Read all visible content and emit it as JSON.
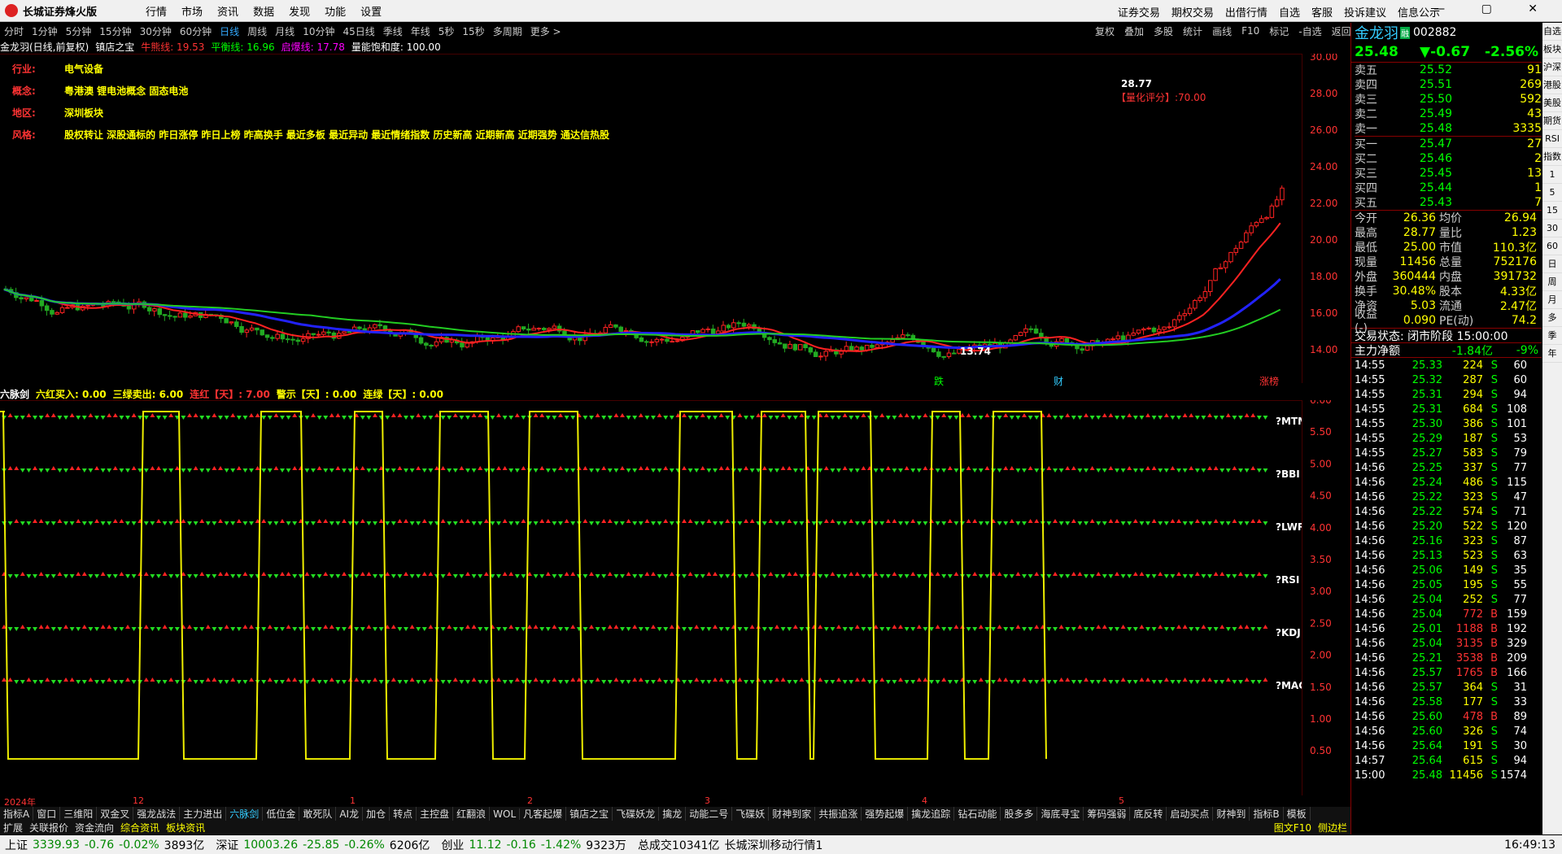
{
  "app": {
    "title": "长城证券烽火版",
    "menu": [
      "行情",
      "市场",
      "资讯",
      "数据",
      "发现",
      "功能",
      "设置"
    ],
    "right_menu": [
      "证券交易",
      "期权交易",
      "出借行情",
      "自选",
      "客服",
      "投诉建议",
      "信息公示"
    ]
  },
  "periods": [
    "分时",
    "1分钟",
    "5分钟",
    "15分钟",
    "30分钟",
    "60分钟",
    "日线",
    "周线",
    "月线",
    "10分钟",
    "45日线",
    "季线",
    "年线",
    "5秒",
    "15秒",
    "多周期",
    "更多 >"
  ],
  "active_period": "日线",
  "toolbar": [
    "复权",
    "叠加",
    "多股",
    "统计",
    "画线",
    "F10",
    "标记",
    "-自选",
    "返回"
  ],
  "chart_header": {
    "name": "金龙羽(日线,前复权)",
    "indicator": "镇店之宝",
    "niu": "牛熊线: 19.53",
    "ping": "平衡线: 16.96",
    "qi": "启爆线: 17.78",
    "liang": "量能饱和度: 100.00"
  },
  "info": [
    {
      "k": "行业:",
      "v": "电气设备"
    },
    {
      "k": "概念:",
      "v": "粤港澳 锂电池概念 固态电池"
    },
    {
      "k": "地区:",
      "v": "深圳板块"
    },
    {
      "k": "风格:",
      "v": "股权转让 深股通标的 昨日涨停 昨日上榜 昨高换手 最近多板 最近异动 最近情绪指数 历史新高 近期新高 近期强势 通达信热股"
    }
  ],
  "score": "【量化评分】:70.00",
  "high_label": "28.77",
  "low_label": "13.74",
  "price_axis": [
    "30.00",
    "28.00",
    "26.00",
    "24.00",
    "22.00",
    "20.00",
    "18.00",
    "16.00",
    "14.00"
  ],
  "ind_header": {
    "name": "六脉剑",
    "a": "六红买入: 0.00",
    "b": "三绿卖出: 6.00",
    "c": "连红【天】: 7.00",
    "d": "警示【天】: 0.00",
    "e": "连绿【天】: 0.00"
  },
  "ind_axis": [
    "6.00",
    "5.50",
    "5.00",
    "4.50",
    "4.00",
    "3.50",
    "3.00",
    "2.50",
    "2.00",
    "1.50",
    "1.00",
    "0.50"
  ],
  "ind_labels": [
    "?MTM",
    "?BBI",
    "?LWR",
    "?RSI",
    "?KDJ",
    "?MACD"
  ],
  "date_labels": [
    "2024年",
    "12",
    "1",
    "2",
    "3",
    "4",
    "5"
  ],
  "market_events": [
    "跌",
    "财",
    "涨榜"
  ],
  "bottom_tabs": [
    "指标A",
    "窗口",
    "三维阳",
    "双金叉",
    "强龙战法",
    "主力进出",
    "六脉剑",
    "低位金",
    "敢死队",
    "AI龙",
    "加仓",
    "转点",
    "主控盘",
    "红翻浪",
    "WOL",
    "凡客起爆",
    "镇店之宝",
    "飞碟妖龙",
    "擒龙",
    "动能二号",
    "飞碟妖",
    "财神到家",
    "共振追涨",
    "强势起爆",
    "擒龙追踪",
    "钻石动能",
    "股多多",
    "海底寻宝",
    "筹码强弱",
    "底反转",
    "启动买点",
    "财神到",
    "指标B",
    "模板"
  ],
  "active_tab": "六脉剑",
  "bottom_tabs2": [
    "扩展",
    "关联报价",
    "资金流向",
    "综合资讯",
    "板块资讯"
  ],
  "bottom_right": [
    "图文F10",
    "侧边栏"
  ],
  "stock": {
    "name": "金龙羽",
    "code": "002882",
    "price": "25.48",
    "change": "▼-0.67",
    "pct": "-2.56%",
    "asks": [
      [
        "卖五",
        "25.52",
        "91"
      ],
      [
        "卖四",
        "25.51",
        "269"
      ],
      [
        "卖三",
        "25.50",
        "592"
      ],
      [
        "卖二",
        "25.49",
        "43"
      ],
      [
        "卖一",
        "25.48",
        "3335"
      ]
    ],
    "bids": [
      [
        "买一",
        "25.47",
        "27"
      ],
      [
        "买二",
        "25.46",
        "2"
      ],
      [
        "买三",
        "25.45",
        "13"
      ],
      [
        "买四",
        "25.44",
        "1"
      ],
      [
        "买五",
        "25.43",
        "7"
      ]
    ],
    "stats": [
      [
        "今开",
        "26.36",
        "均价",
        "26.94"
      ],
      [
        "最高",
        "28.77",
        "量比",
        "1.23"
      ],
      [
        "最低",
        "25.00",
        "市值",
        "110.3亿"
      ],
      [
        "现量",
        "11456",
        "总量",
        "752176"
      ],
      [
        "外盘",
        "360444",
        "内盘",
        "391732"
      ],
      [
        "换手",
        "30.48%",
        "股本",
        "4.33亿"
      ],
      [
        "净资",
        "5.03",
        "流通",
        "2.47亿"
      ],
      [
        "收益(-)",
        "0.090",
        "PE(动)",
        "74.2"
      ]
    ],
    "state": "交易状态: 闭市阶段 15:00:00",
    "flow_label": "主力净额",
    "flow_val": "-1.84亿",
    "flow_pct": "-9%"
  },
  "ticks": [
    [
      "14:55",
      "25.33",
      "224",
      "S",
      "60"
    ],
    [
      "14:55",
      "25.32",
      "287",
      "S",
      "60"
    ],
    [
      "14:55",
      "25.31",
      "294",
      "S",
      "94"
    ],
    [
      "14:55",
      "25.31",
      "684",
      "S",
      "108"
    ],
    [
      "14:55",
      "25.30",
      "386",
      "S",
      "101"
    ],
    [
      "14:55",
      "25.29",
      "187",
      "S",
      "53"
    ],
    [
      "14:55",
      "25.27",
      "583",
      "S",
      "79"
    ],
    [
      "14:56",
      "25.25",
      "337",
      "S",
      "77"
    ],
    [
      "14:56",
      "25.24",
      "486",
      "S",
      "115"
    ],
    [
      "14:56",
      "25.22",
      "323",
      "S",
      "47"
    ],
    [
      "14:56",
      "25.22",
      "574",
      "S",
      "71"
    ],
    [
      "14:56",
      "25.20",
      "522",
      "S",
      "120"
    ],
    [
      "14:56",
      "25.16",
      "323",
      "S",
      "87"
    ],
    [
      "14:56",
      "25.13",
      "523",
      "S",
      "63"
    ],
    [
      "14:56",
      "25.06",
      "149",
      "S",
      "35"
    ],
    [
      "14:56",
      "25.05",
      "195",
      "S",
      "55"
    ],
    [
      "14:56",
      "25.04",
      "252",
      "S",
      "77"
    ],
    [
      "14:56",
      "25.04",
      "772",
      "B",
      "159"
    ],
    [
      "14:56",
      "25.01",
      "1188",
      "B",
      "192"
    ],
    [
      "14:56",
      "25.04",
      "3135",
      "B",
      "329"
    ],
    [
      "14:56",
      "25.21",
      "3538",
      "B",
      "209"
    ],
    [
      "14:56",
      "25.57",
      "1765",
      "B",
      "166"
    ],
    [
      "14:56",
      "25.57",
      "364",
      "S",
      "31"
    ],
    [
      "14:56",
      "25.58",
      "177",
      "S",
      "33"
    ],
    [
      "14:56",
      "25.60",
      "478",
      "B",
      "89"
    ],
    [
      "14:56",
      "25.60",
      "326",
      "S",
      "74"
    ],
    [
      "14:56",
      "25.64",
      "191",
      "S",
      "30"
    ],
    [
      "14:57",
      "25.64",
      "615",
      "S",
      "94"
    ],
    [
      "15:00",
      "25.48",
      "11456",
      "S",
      "1574"
    ]
  ],
  "status": {
    "sh": "上证",
    "sh_v": "3339.93",
    "sh_c": "-0.76",
    "sh_p": "-0.02%",
    "sh_a": "3893亿",
    "sz": "深证",
    "sz_v": "10003.26",
    "sz_c": "-25.85",
    "sz_p": "-0.26%",
    "sz_a": "6206亿",
    "cy": "创业",
    "cy_v": "11.12",
    "cy_c": "-0.16",
    "cy_p": "-1.42%",
    "cy_a": "9323万",
    "total": "总成交10341亿",
    "feed": "长城深圳移动行情1",
    "time": "16:49:13"
  },
  "sidebar": [
    "自选",
    "板块",
    "沪深",
    "港股",
    "美股",
    "期货",
    "RSI",
    "指数",
    "1",
    "5",
    "15",
    "30",
    "60",
    "日",
    "周",
    "月",
    "多",
    "季",
    "年"
  ],
  "colors": {
    "up": "#ff3333",
    "down": "#00ff00",
    "accent": "#ffff00"
  }
}
